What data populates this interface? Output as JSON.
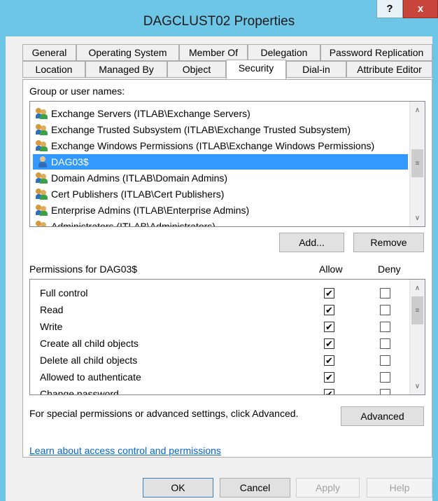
{
  "window": {
    "title": "DAGCLUST02 Properties",
    "help_label": "?",
    "close_label": "x"
  },
  "tabs": {
    "row1": [
      {
        "label": "General"
      },
      {
        "label": "Operating System"
      },
      {
        "label": "Member Of"
      },
      {
        "label": "Delegation"
      },
      {
        "label": "Password Replication"
      }
    ],
    "row2": [
      {
        "label": "Location"
      },
      {
        "label": "Managed By"
      },
      {
        "label": "Object"
      },
      {
        "label": "Security"
      },
      {
        "label": "Dial-in"
      },
      {
        "label": "Attribute Editor"
      }
    ],
    "active": "Security"
  },
  "security": {
    "group_label": "Group or user names:",
    "users": [
      {
        "icon": "group-icon",
        "name": "Exchange Servers (ITLAB\\Exchange Servers)"
      },
      {
        "icon": "group-icon",
        "name": "Exchange Trusted Subsystem (ITLAB\\Exchange Trusted Subsystem)"
      },
      {
        "icon": "group-icon",
        "name": "Exchange Windows Permissions (ITLAB\\Exchange Windows Permissions)"
      },
      {
        "icon": "user-icon",
        "name": "DAG03$",
        "selected": true
      },
      {
        "icon": "group-icon",
        "name": "Domain Admins (ITLAB\\Domain Admins)"
      },
      {
        "icon": "group-icon",
        "name": "Cert Publishers (ITLAB\\Cert Publishers)"
      },
      {
        "icon": "group-icon",
        "name": "Enterprise Admins (ITLAB\\Enterprise Admins)"
      },
      {
        "icon": "group-icon",
        "name": "Administrators (ITLAB\\Administrators)"
      }
    ],
    "add_label": "Add...",
    "remove_label": "Remove",
    "permissions_label": "Permissions for DAG03$",
    "allow_header": "Allow",
    "deny_header": "Deny",
    "permissions": [
      {
        "name": "Full control",
        "allow": true,
        "deny": false
      },
      {
        "name": "Read",
        "allow": true,
        "deny": false
      },
      {
        "name": "Write",
        "allow": true,
        "deny": false
      },
      {
        "name": "Create all child objects",
        "allow": true,
        "deny": false
      },
      {
        "name": "Delete all child objects",
        "allow": true,
        "deny": false
      },
      {
        "name": "Allowed to authenticate",
        "allow": true,
        "deny": false
      },
      {
        "name": "Change password",
        "allow": true,
        "deny": false
      }
    ],
    "advanced_text": "For special permissions or advanced settings, click Advanced.",
    "advanced_label": "Advanced",
    "learn_link": "Learn about access control and permissions"
  },
  "footer": {
    "ok_label": "OK",
    "cancel_label": "Cancel",
    "apply_label": "Apply",
    "help_label": "Help"
  },
  "glyphs": {
    "check": "✔",
    "up": "∧",
    "down": "∨",
    "grip": "≡"
  }
}
